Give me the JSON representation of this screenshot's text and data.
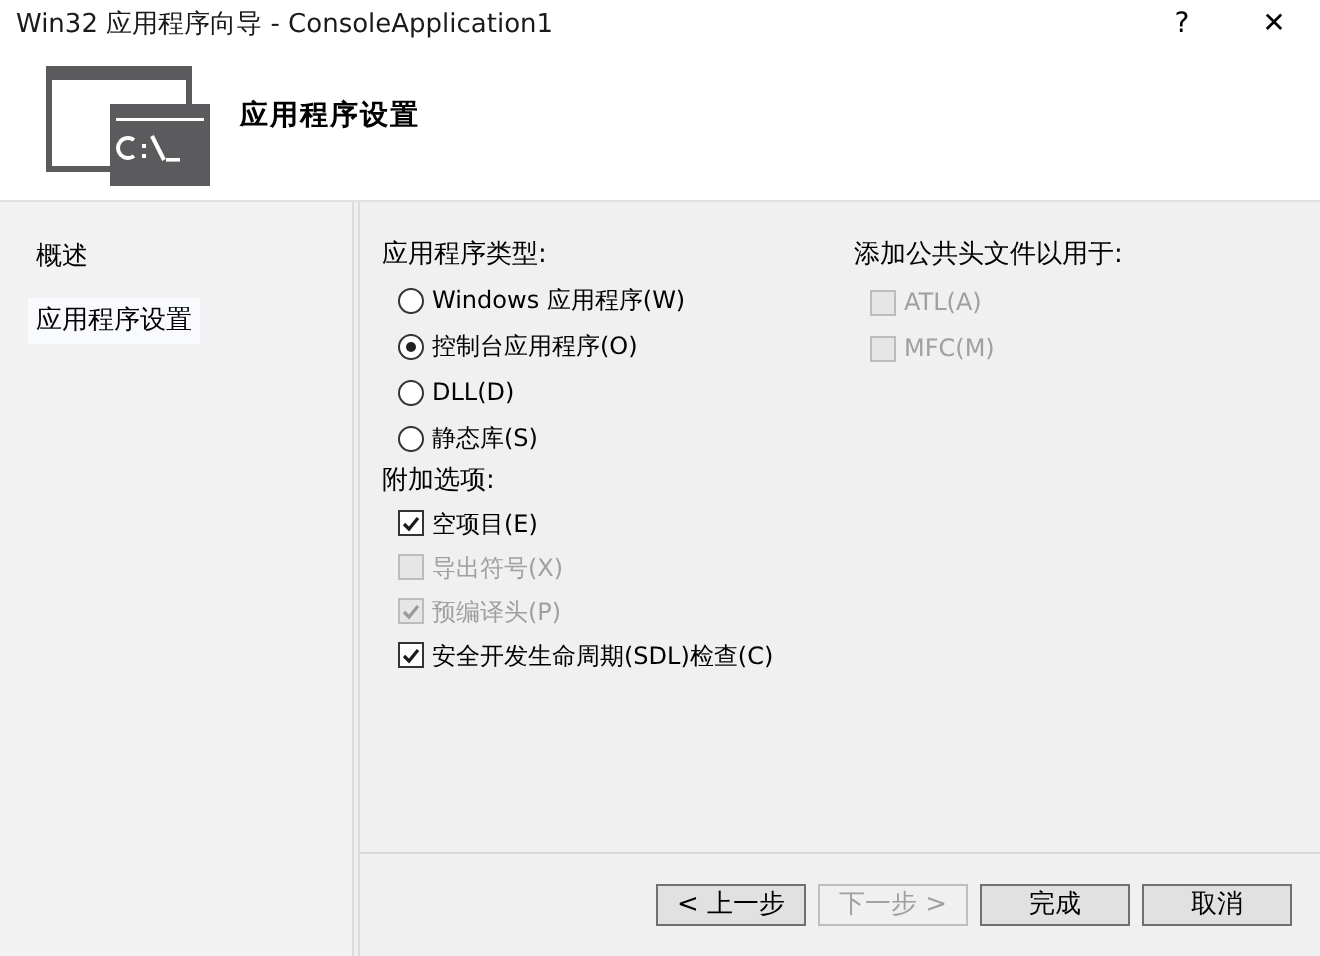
{
  "window": {
    "title": "Win32 应用程序向导 - ConsoleApplication1",
    "help": "?",
    "close": "✕"
  },
  "header": {
    "title": "应用程序设置"
  },
  "sidebar": {
    "items": [
      {
        "label": "概述",
        "selected": false
      },
      {
        "label": "应用程序设置",
        "selected": true
      }
    ]
  },
  "app_type": {
    "label": "应用程序类型:",
    "options": [
      {
        "label": "Windows 应用程序(W)",
        "selected": false
      },
      {
        "label": "控制台应用程序(O)",
        "selected": true
      },
      {
        "label": "DLL(D)",
        "selected": false
      },
      {
        "label": "静态库(S)",
        "selected": false
      }
    ]
  },
  "extra_options": {
    "label": "附加选项:",
    "items": [
      {
        "label": "空项目(E)",
        "checked": true,
        "disabled": false
      },
      {
        "label": "导出符号(X)",
        "checked": false,
        "disabled": true
      },
      {
        "label": "预编译头(P)",
        "checked": true,
        "disabled": true
      },
      {
        "label": "安全开发生命周期(SDL)检查(C)",
        "checked": true,
        "disabled": false
      }
    ]
  },
  "common_headers": {
    "label": "添加公共头文件以用于:",
    "items": [
      {
        "label": "ATL(A)",
        "checked": false,
        "disabled": true
      },
      {
        "label": "MFC(M)",
        "checked": false,
        "disabled": true
      }
    ]
  },
  "buttons": [
    {
      "label": "< 上一步",
      "disabled": false
    },
    {
      "label": "下一步 >",
      "disabled": true
    },
    {
      "label": "完成",
      "disabled": false
    },
    {
      "label": "取消",
      "disabled": false
    }
  ]
}
